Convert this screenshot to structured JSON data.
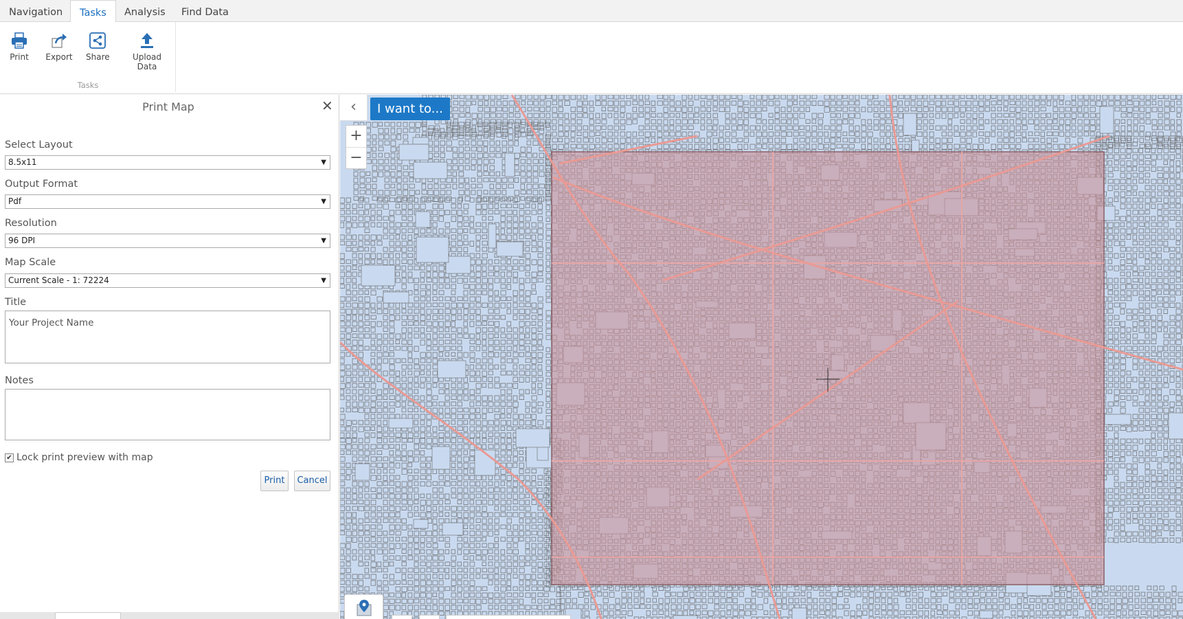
{
  "tabs": [
    "Navigation",
    "Tasks",
    "Analysis",
    "Find Data"
  ],
  "active_tab": "Tasks",
  "ribbon": {
    "buttons": [
      {
        "label": "Print",
        "icon": "printer-icon"
      },
      {
        "label": "Export",
        "icon": "export-icon"
      },
      {
        "label": "Share",
        "icon": "share-icon"
      },
      {
        "label": "Upload Data",
        "icon": "upload-icon"
      }
    ],
    "group_label": "Tasks"
  },
  "panel": {
    "title": "Print Map",
    "close": "✕",
    "fields": {
      "layout": {
        "label": "Select Layout",
        "value": "8.5x11"
      },
      "format": {
        "label": "Output Format",
        "value": "Pdf"
      },
      "resolution": {
        "label": "Resolution",
        "value": "96 DPI"
      },
      "scale": {
        "label": "Map Scale",
        "value": "Current Scale - 1: 72224"
      },
      "title": {
        "label": "Title",
        "value": "Your Project Name"
      },
      "notes": {
        "label": "Notes",
        "value": ""
      }
    },
    "lock_label": "Lock print preview with map",
    "lock_checked": true,
    "print_button": "Print",
    "cancel_button": "Cancel"
  },
  "map": {
    "i_want_to": "I want to...",
    "back": "‹",
    "zoom_in": "+",
    "zoom_out": "−",
    "colors": {
      "water": "#c9daf0",
      "streets": "#6b6b6b",
      "print_extent": "#c9939b"
    }
  }
}
